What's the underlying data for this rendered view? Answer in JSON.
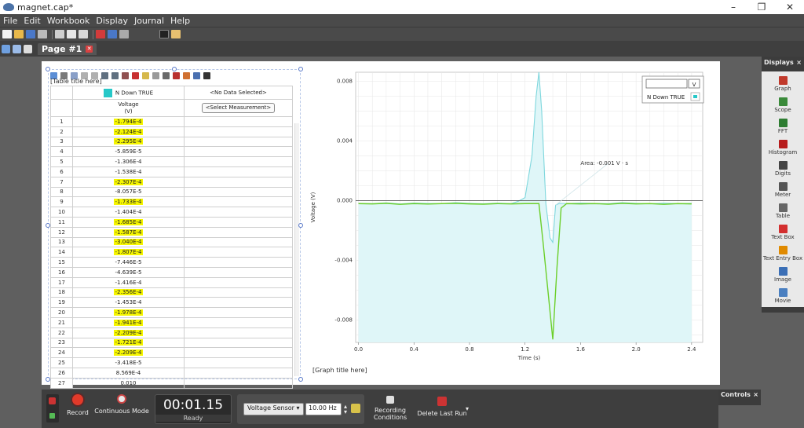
{
  "window": {
    "title": "magnet.cap*",
    "minimize": "–",
    "maximize": "❐",
    "close": "✕"
  },
  "menu": [
    "File",
    "Edit",
    "Workbook",
    "Display",
    "Journal",
    "Help"
  ],
  "page_tab": {
    "label": "Page #1",
    "close": "✕"
  },
  "table": {
    "title_placeholder": "[Table title here]",
    "col1_header": "N Down TRUE",
    "col2_header": "<No Data Selected>",
    "col1_subheader": "Voltage",
    "col1_unit": "(V)",
    "select_measurement": "<Select Measurement>",
    "rows": [
      {
        "i": "1",
        "v": "-1.794E-4",
        "hl": true
      },
      {
        "i": "2",
        "v": "-2.124E-4",
        "hl": true
      },
      {
        "i": "3",
        "v": "-2.295E-4",
        "hl": true
      },
      {
        "i": "4",
        "v": "-5.859E-5",
        "hl": false
      },
      {
        "i": "5",
        "v": "-1.306E-4",
        "hl": false
      },
      {
        "i": "6",
        "v": "-1.538E-4",
        "hl": false
      },
      {
        "i": "7",
        "v": "-2.307E-4",
        "hl": true
      },
      {
        "i": "8",
        "v": "-8.057E-5",
        "hl": false
      },
      {
        "i": "9",
        "v": "-1.733E-4",
        "hl": true
      },
      {
        "i": "10",
        "v": "-1.404E-4",
        "hl": false
      },
      {
        "i": "11",
        "v": "-1.685E-4",
        "hl": true
      },
      {
        "i": "12",
        "v": "-1.587E-4",
        "hl": true
      },
      {
        "i": "13",
        "v": "-3.040E-4",
        "hl": true
      },
      {
        "i": "14",
        "v": "-1.807E-4",
        "hl": true
      },
      {
        "i": "15",
        "v": "-7.446E-5",
        "hl": false
      },
      {
        "i": "16",
        "v": "-4.639E-5",
        "hl": false
      },
      {
        "i": "17",
        "v": "-1.416E-4",
        "hl": false
      },
      {
        "i": "18",
        "v": "-2.356E-4",
        "hl": true
      },
      {
        "i": "19",
        "v": "-1.453E-4",
        "hl": false
      },
      {
        "i": "20",
        "v": "-1.978E-4",
        "hl": true
      },
      {
        "i": "21",
        "v": "-1.941E-4",
        "hl": true
      },
      {
        "i": "22",
        "v": "-2.209E-4",
        "hl": true
      },
      {
        "i": "23",
        "v": "-1.721E-4",
        "hl": true
      },
      {
        "i": "24",
        "v": "-2.209E-4",
        "hl": true
      },
      {
        "i": "25",
        "v": "-3.418E-5",
        "hl": false
      },
      {
        "i": "26",
        "v": "8.569E-4",
        "hl": false
      },
      {
        "i": "27",
        "v": "0.010",
        "hl": false
      }
    ]
  },
  "graph": {
    "title_placeholder": "[Graph title here]",
    "xlabel": "Time (s)",
    "ylabel": "Voltage (V)",
    "x_ticks": [
      "0.0",
      "0.4",
      "0.8",
      "1.2",
      "1.6",
      "2.0",
      "2.4"
    ],
    "y_ticks": [
      "0.008",
      "0.004",
      "0.000",
      "-0.004",
      "-0.008"
    ],
    "annotation": "Area: -0.001 V · s",
    "legend_unit": "V",
    "legend_series": "N Down TRUE",
    "colors": {
      "fill": "#dff6f8",
      "series": "#7fd7dd",
      "highlight": "#6ccf2a",
      "grid": "#e6e6e6"
    }
  },
  "chart_data": {
    "type": "line",
    "xlabel": "Time (s)",
    "ylabel": "Voltage (V)",
    "xlim": [
      -0.02,
      2.48
    ],
    "ylim": [
      -0.0095,
      0.0086
    ],
    "grid": true,
    "legend_position": "top-right",
    "series": [
      {
        "name": "N Down TRUE",
        "color": "#7fd7dd",
        "x": [
          0.0,
          0.1,
          0.2,
          0.3,
          0.4,
          0.5,
          0.6,
          0.7,
          0.8,
          0.9,
          1.0,
          1.1,
          1.15,
          1.2,
          1.25,
          1.28,
          1.3,
          1.32,
          1.35,
          1.38,
          1.4,
          1.42,
          1.45,
          1.5,
          1.6,
          1.7,
          1.8,
          1.9,
          2.0,
          2.1,
          2.2,
          2.3,
          2.4
        ],
        "y": [
          -0.00018,
          -0.0002,
          -0.00015,
          -0.00022,
          -0.00016,
          -0.00019,
          -0.0002,
          -0.00014,
          -0.00018,
          -0.00021,
          -0.00017,
          -0.0002,
          -5e-05,
          0.0002,
          0.003,
          0.007,
          0.0105,
          0.006,
          -0.0002,
          -0.0025,
          -0.0028,
          -0.0003,
          -0.00018,
          -0.0002,
          -0.00016,
          -0.00019,
          -0.0002,
          -0.00014,
          -0.00018,
          -0.00021,
          -0.00017,
          -0.0002,
          -0.00018
        ]
      },
      {
        "name": "",
        "color": "#6ccf2a",
        "x": [
          0.0,
          0.1,
          0.2,
          0.3,
          0.4,
          0.5,
          0.6,
          0.7,
          0.8,
          0.9,
          1.0,
          1.1,
          1.2,
          1.3,
          1.33,
          1.37,
          1.4,
          1.43,
          1.46,
          1.5,
          1.6,
          1.7,
          1.8,
          1.9,
          2.0,
          2.1,
          2.2,
          2.3,
          2.4
        ],
        "y": [
          -0.0002,
          -0.00022,
          -0.00018,
          -0.00025,
          -0.0002,
          -0.00023,
          -0.0002,
          -0.00018,
          -0.00022,
          -0.00024,
          -0.0002,
          -0.00022,
          -0.0002,
          -0.0002,
          -0.0028,
          -0.0065,
          -0.0093,
          -0.0045,
          -0.0005,
          -0.0002,
          -0.00022,
          -0.0002,
          -0.00024,
          -0.00018,
          -0.00022,
          -0.0002,
          -0.00025,
          -0.0002,
          -0.00022
        ]
      }
    ]
  },
  "displays": {
    "title": "Displays",
    "close": "×",
    "items": [
      {
        "label": "Graph",
        "icon": "graph-icon",
        "color": "#c0392b"
      },
      {
        "label": "Scope",
        "icon": "scope-icon",
        "color": "#3a8a3a"
      },
      {
        "label": "FFT",
        "icon": "fft-icon",
        "color": "#2e7d32"
      },
      {
        "label": "Histogram",
        "icon": "histogram-icon",
        "color": "#b71c1c"
      },
      {
        "label": "Digits",
        "icon": "digits-icon",
        "color": "#444444"
      },
      {
        "label": "Meter",
        "icon": "meter-icon",
        "color": "#555555"
      },
      {
        "label": "Table",
        "icon": "table-icon",
        "color": "#666666"
      },
      {
        "label": "Text Box",
        "icon": "text-box-icon",
        "color": "#d32f2f"
      },
      {
        "label": "Text Entry Box",
        "icon": "text-entry-box-icon",
        "color": "#e08a00"
      },
      {
        "label": "Image",
        "icon": "image-icon",
        "color": "#3b6fb6"
      },
      {
        "label": "Movie",
        "icon": "movie-icon",
        "color": "#4a7fc0"
      }
    ]
  },
  "controls": {
    "title": "Controls",
    "close": "×",
    "record": "Record",
    "continuous_mode": "Continuous Mode",
    "timer": "00:01.15",
    "status": "Ready",
    "sensor": "Voltage Sensor",
    "rate": "10.00 Hz",
    "recording_conditions_line1": "Recording",
    "recording_conditions_line2": "Conditions",
    "delete_last_run": "Delete Last Run"
  }
}
